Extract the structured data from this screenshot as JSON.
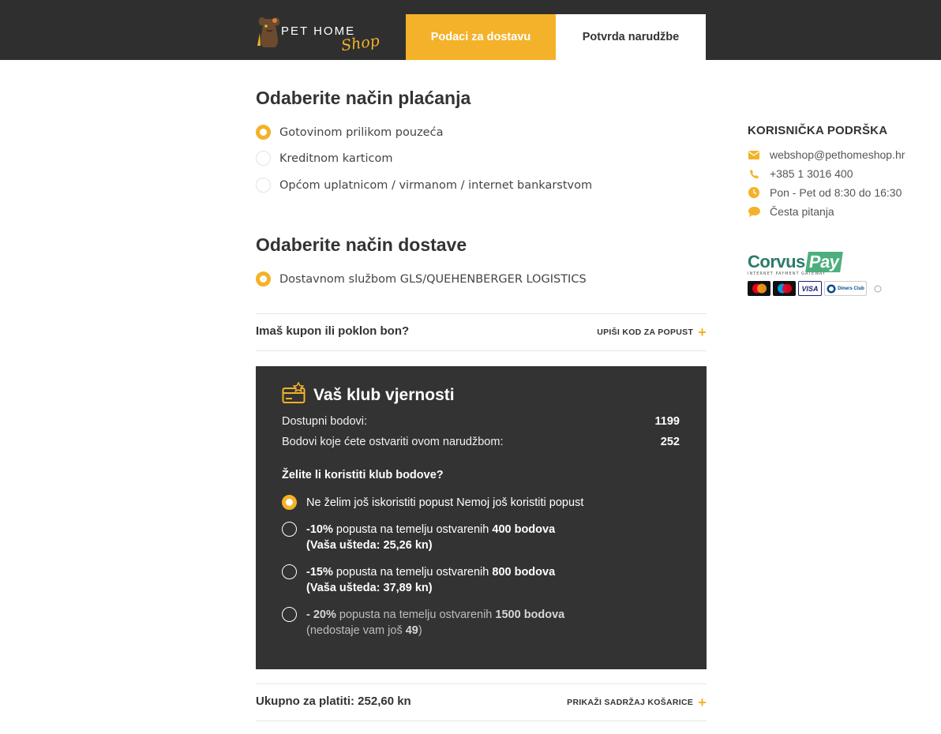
{
  "header": {
    "logo_text": "PET HOME",
    "logo_script": "Shop",
    "tabs": [
      {
        "label": "Podaci za dostavu",
        "active": true
      },
      {
        "label": "Potvrda narudžbe",
        "active": false
      }
    ]
  },
  "payment": {
    "title": "Odaberite način plaćanja",
    "options": [
      {
        "label": "Gotovinom prilikom pouzeća",
        "selected": true
      },
      {
        "label": "Kreditnom karticom",
        "selected": false
      },
      {
        "label": "Općom uplatnicom / virmanom / internet bankarstvom",
        "selected": false
      }
    ]
  },
  "delivery": {
    "title": "Odaberite način dostave",
    "options": [
      {
        "label": "Dostavnom službom GLS/QUEHENBERGER LOGISTICS",
        "selected": true
      }
    ]
  },
  "coupon": {
    "label": "Imaš kupon ili poklon bon?",
    "action": "UPIŠI KOD ZA POPUST"
  },
  "loyalty": {
    "title": "Vaš klub vjernosti",
    "available_label": "Dostupni bodovi:",
    "available_value": "1199",
    "earn_label": "Bodovi koje ćete ostvariti ovom narudžbom:",
    "earn_value": "252",
    "question": "Želite li koristiti klub bodove?",
    "options": [
      {
        "text": "Ne želim još iskoristiti popust Nemoj još koristiti popust",
        "selected": true
      },
      {
        "discount": "-10%",
        "mid": " popusta na temelju ostvarenih ",
        "points": "400 bodova",
        "saving": "(Vaša ušteda: 25,26 kn)",
        "selected": false
      },
      {
        "discount": "-15%",
        "mid": " popusta na temelju ostvarenih ",
        "points": "800 bodova",
        "saving": "(Vaša ušteda: 37,89 kn)",
        "selected": false
      },
      {
        "discount": "- 20%",
        "mid": " popusta na temelju ostvarenih ",
        "points": "1500 bodova",
        "missing_prefix": "(nedostaje vam još ",
        "missing_value": "49",
        "missing_suffix": ")",
        "selected": false
      }
    ]
  },
  "total": {
    "label": "Ukupno za platiti: 252,60 kn",
    "action": "PRIKAŽI SADRŽAJ KOŠARICE"
  },
  "support": {
    "title": "KORISNIČKA PODRŠKA",
    "email": "webshop@pethomeshop.hr",
    "phone": "+385 1 3016 400",
    "hours": "Pon - Pet od 8:30 do 16:30",
    "faq": "Česta pitanja"
  },
  "corvus": {
    "name_a": "Corvus",
    "name_b": "Pay",
    "subtitle": "INTERNET PAYMENT GATEWAY",
    "card_labels": [
      "mastercard",
      "maestro",
      "VISA",
      "Diners Club",
      "Discover"
    ]
  },
  "colors": {
    "accent": "#f3b229",
    "dark": "#333333",
    "header": "#2f2f2f"
  }
}
